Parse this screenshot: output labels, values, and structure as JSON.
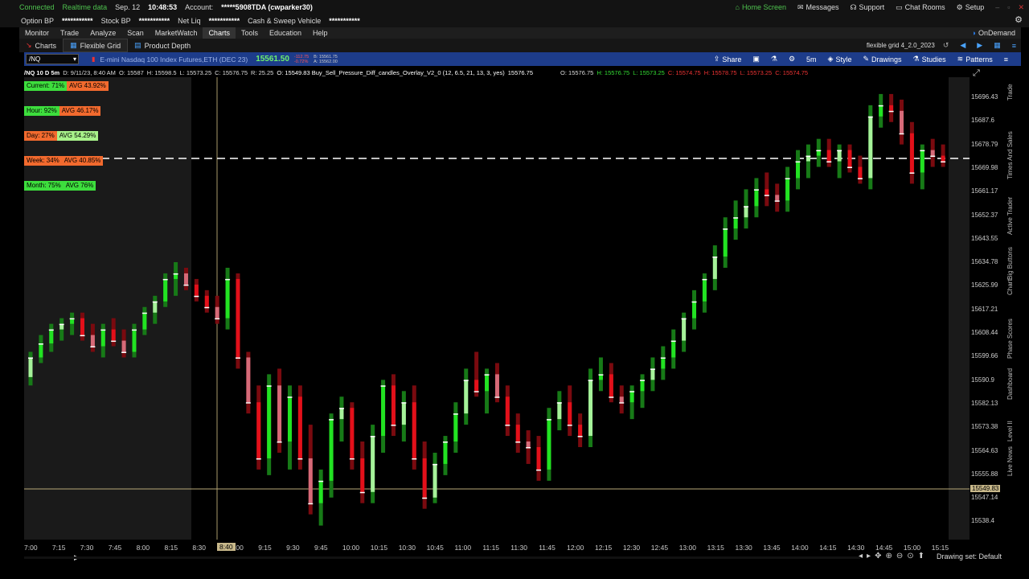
{
  "status_bar": {
    "connected": "Connected",
    "realtime": "Realtime data",
    "date": "Sep. 12",
    "time": "10:48:53",
    "account_label": "Account:",
    "account_value": "*****5908TDA (cwparker30)",
    "option_bp_label": "Option BP",
    "option_bp_value": "***********",
    "stock_bp_label": "Stock BP",
    "stock_bp_value": "***********",
    "net_liq_label": "Net Liq",
    "net_liq_value": "***********",
    "cash_label": "Cash & Sweep Vehicle",
    "cash_value": "***********"
  },
  "top_right": {
    "home": "Home Screen",
    "messages": "Messages",
    "support": "Support",
    "chat": "Chat Rooms",
    "setup": "Setup"
  },
  "menu": [
    "Monitor",
    "Trade",
    "Analyze",
    "Scan",
    "MarketWatch",
    "Charts",
    "Tools",
    "Education",
    "Help"
  ],
  "menu_active": "Charts",
  "on_demand": "OnDemand",
  "tabs": {
    "charts": "Charts",
    "flexible_grid": "Flexible Grid",
    "product_depth": "Product Depth"
  },
  "grid_name": "flexible grid 4_2.0_2023",
  "toolbar": {
    "symbol": "/NQ",
    "description": "E-mini Nasdaq 100 Index Futures,ETH (DEC 23)",
    "price": "15561.50",
    "change_net": "-112.75",
    "change_pct": "-0.72%",
    "bid": "B: 15561.75",
    "ask": "A: 15562.00",
    "share": "Share",
    "timeframe": "5m",
    "style": "Style",
    "drawings": "Drawings",
    "studies": "Studies",
    "patterns": "Patterns"
  },
  "infobar": {
    "series": "/NQ 10 D 5m",
    "date": "D: 9/11/23, 8:40 AM",
    "open": "O: 15587",
    "high": "H: 15598.5",
    "low": "L: 15573.25",
    "close": "C: 15576.75",
    "range": "R: 25.25",
    "study": "O: 15549.83  Buy_Sell_Pressure_Diff_candles_Overlay_V2_0 (12, 6.5, 21, 13, 3, yes)",
    "study_value": "15576.75",
    "o2": "O: 15576.75",
    "h2": "H: 15576.75",
    "l2": "L: 15573.25",
    "c2": "C: 15574.75",
    "h3": "H: 15578.75",
    "l3": "L: 15573.25",
    "c3": "C: 15574.75"
  },
  "badges": [
    {
      "left": "Current: 71%",
      "right": "AVG 43.92%",
      "left_color": "#3dde3d",
      "right_color": "#f26a2e"
    },
    {
      "left": "Hour: 92%",
      "right": "AVG 46.17%",
      "left_color": "#3dde3d",
      "right_color": "#f26a2e"
    },
    {
      "left": "Day: 27%",
      "right": "AVG 54.29%",
      "left_color": "#f26a2e",
      "right_color": "#a8f28a"
    },
    {
      "left": "Week: 34%",
      "right": "AVG 40.85%",
      "left_color": "#f26a2e",
      "right_color": "#f26a2e"
    },
    {
      "left": "Month: 75%",
      "right": "AVG 76%",
      "left_color": "#3dde3d",
      "right_color": "#3dde3d"
    }
  ],
  "y_labels": [
    "15696.43",
    "15687.6",
    "15678.79",
    "15669.98",
    "15661.17",
    "15652.37",
    "15643.55",
    "15634.78",
    "15625.99",
    "15617.21",
    "15608.44",
    "15599.66",
    "15590.9",
    "15582.13",
    "15573.38",
    "15564.63",
    "15555.88",
    "15547.14",
    "15538.4"
  ],
  "price_tag": "15549.83",
  "x_labels": [
    "7:00",
    "7:15",
    "7:30",
    "7:45",
    "8:00",
    "8:15",
    "8:30",
    "8:40",
    "9:00",
    "9:15",
    "9:30",
    "9:45",
    "10:00",
    "10:15",
    "10:30",
    "10:45",
    "11:00",
    "11:15",
    "11:30",
    "11:45",
    "12:00",
    "12:15",
    "12:30",
    "12:45",
    "13:00",
    "13:15",
    "13:30",
    "13:45",
    "14:00",
    "14:15",
    "14:30",
    "14:45",
    "15:00",
    "15:15"
  ],
  "cursor_label": "8:40",
  "side_tabs": [
    "Trade",
    "Times And Sales",
    "Active Trader",
    "Big Buttons",
    "Chart",
    "Phase Scores",
    "Dashboard",
    "Level II",
    "Live News"
  ],
  "drawing_set": "Drawing set: Default",
  "colors": {
    "bull": "#22e322",
    "bull_light": "#a6f29a",
    "bear": "#e3101a",
    "bear_light": "#d66a78",
    "toolbar": "#1d3c8a"
  },
  "chart_data": {
    "type": "candlestick",
    "interval": "5m",
    "candles": [
      [
        15593,
        15602,
        15590,
        15600
      ],
      [
        15600,
        15608,
        15598,
        15605
      ],
      [
        15605,
        15612,
        15602,
        15610
      ],
      [
        15610,
        15614,
        15606,
        15612
      ],
      [
        15612,
        15616,
        15608,
        15614
      ],
      [
        15614,
        15616,
        15606,
        15608
      ],
      [
        15608,
        15612,
        15602,
        15604
      ],
      [
        15604,
        15612,
        15600,
        15610
      ],
      [
        15610,
        15614,
        15604,
        15606
      ],
      [
        15606,
        15610,
        15600,
        15602
      ],
      [
        15602,
        15612,
        15600,
        15610
      ],
      [
        15610,
        15618,
        15608,
        15616
      ],
      [
        15616,
        15622,
        15612,
        15620
      ],
      [
        15620,
        15630,
        15618,
        15628
      ],
      [
        15628,
        15634,
        15622,
        15630
      ],
      [
        15630,
        15632,
        15624,
        15626
      ],
      [
        15626,
        15628,
        15620,
        15622
      ],
      [
        15622,
        15624,
        15616,
        15618
      ],
      [
        15618,
        15622,
        15612,
        15614
      ],
      [
        15614,
        15632,
        15610,
        15628
      ],
      [
        15628,
        15630,
        15596,
        15600
      ],
      [
        15600,
        15602,
        15580,
        15584
      ],
      [
        15584,
        15590,
        15560,
        15564
      ],
      [
        15564,
        15594,
        15558,
        15590
      ],
      [
        15590,
        15596,
        15566,
        15570
      ],
      [
        15570,
        15590,
        15560,
        15586
      ],
      [
        15586,
        15590,
        15560,
        15564
      ],
      [
        15564,
        15576,
        15544,
        15548
      ],
      [
        15548,
        15560,
        15540,
        15556
      ],
      [
        15556,
        15580,
        15550,
        15578
      ],
      [
        15578,
        15586,
        15570,
        15582
      ],
      [
        15582,
        15584,
        15560,
        15564
      ],
      [
        15564,
        15570,
        15548,
        15552
      ],
      [
        15552,
        15576,
        15548,
        15572
      ],
      [
        15572,
        15592,
        15566,
        15590
      ],
      [
        15590,
        15594,
        15572,
        15576
      ],
      [
        15576,
        15588,
        15570,
        15584
      ],
      [
        15584,
        15590,
        15560,
        15564
      ],
      [
        15564,
        15570,
        15546,
        15550
      ],
      [
        15550,
        15566,
        15548,
        15562
      ],
      [
        15562,
        15572,
        15558,
        15570
      ],
      [
        15570,
        15584,
        15566,
        15580
      ],
      [
        15580,
        15596,
        15576,
        15592
      ],
      [
        15592,
        15602,
        15586,
        15588
      ],
      [
        15588,
        15596,
        15580,
        15594
      ],
      [
        15594,
        15598,
        15584,
        15586
      ],
      [
        15586,
        15590,
        15572,
        15576
      ],
      [
        15576,
        15580,
        15566,
        15570
      ],
      [
        15570,
        15574,
        15562,
        15568
      ],
      [
        15568,
        15572,
        15556,
        15560
      ],
      [
        15560,
        15582,
        15556,
        15578
      ],
      [
        15578,
        15588,
        15574,
        15584
      ],
      [
        15584,
        15590,
        15572,
        15576
      ],
      [
        15576,
        15580,
        15568,
        15572
      ],
      [
        15572,
        15596,
        15568,
        15592
      ],
      [
        15592,
        15600,
        15588,
        15594
      ],
      [
        15594,
        15598,
        15584,
        15586
      ],
      [
        15586,
        15590,
        15580,
        15584
      ],
      [
        15584,
        15590,
        15578,
        15588
      ],
      [
        15588,
        15594,
        15582,
        15592
      ],
      [
        15592,
        15600,
        15588,
        15596
      ],
      [
        15596,
        15604,
        15592,
        15600
      ],
      [
        15600,
        15610,
        15596,
        15606
      ],
      [
        15606,
        15616,
        15602,
        15614
      ],
      [
        15614,
        15624,
        15610,
        15620
      ],
      [
        15620,
        15630,
        15616,
        15628
      ],
      [
        15628,
        15640,
        15624,
        15636
      ],
      [
        15636,
        15650,
        15632,
        15646
      ],
      [
        15646,
        15656,
        15642,
        15650
      ],
      [
        15650,
        15660,
        15646,
        15654
      ],
      [
        15654,
        15664,
        15650,
        15660
      ],
      [
        15660,
        15666,
        15654,
        15658
      ],
      [
        15658,
        15662,
        15652,
        15656
      ],
      [
        15656,
        15668,
        15652,
        15664
      ],
      [
        15664,
        15674,
        15660,
        15670
      ],
      [
        15670,
        15676,
        15664,
        15672
      ],
      [
        15672,
        15678,
        15668,
        15674
      ],
      [
        15674,
        15678,
        15668,
        15670
      ],
      [
        15670,
        15676,
        15664,
        15674
      ],
      [
        15674,
        15676,
        15666,
        15668
      ],
      [
        15668,
        15672,
        15662,
        15664
      ],
      [
        15664,
        15690,
        15660,
        15686
      ],
      [
        15686,
        15694,
        15682,
        15690
      ],
      [
        15690,
        15694,
        15684,
        15688
      ],
      [
        15688,
        15692,
        15676,
        15680
      ],
      [
        15680,
        15684,
        15662,
        15666
      ],
      [
        15666,
        15676,
        15660,
        15674
      ],
      [
        15674,
        15678,
        15668,
        15672
      ],
      [
        15672,
        15676,
        15668,
        15670
      ]
    ],
    "last_price": 15549.83,
    "ylim": [
      15535,
      15700
    ]
  }
}
